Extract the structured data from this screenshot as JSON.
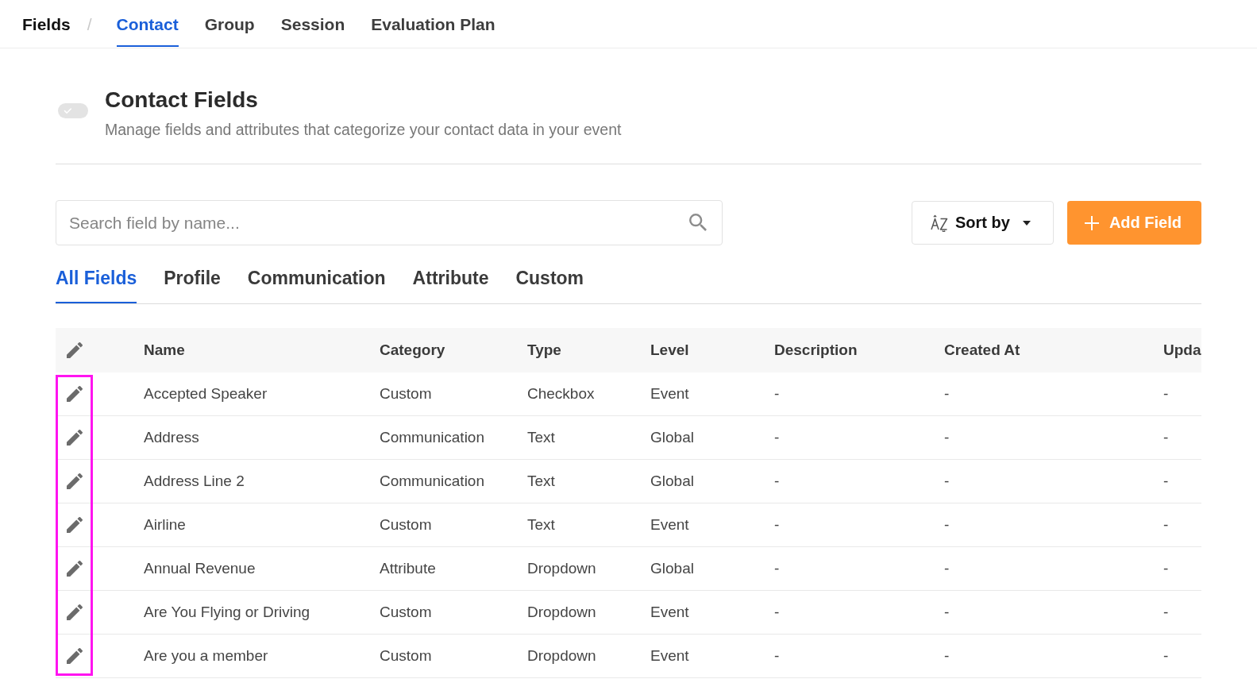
{
  "breadcrumb": {
    "root": "Fields",
    "separator": "/"
  },
  "nav_tabs": [
    {
      "label": "Contact",
      "selected": true
    },
    {
      "label": "Group",
      "selected": false
    },
    {
      "label": "Session",
      "selected": false
    },
    {
      "label": "Evaluation Plan",
      "selected": false
    }
  ],
  "header": {
    "toggle": {
      "on": true,
      "disabled": true
    },
    "title": "Contact Fields",
    "subtitle": "Manage fields and attributes that categorize your contact data in your event"
  },
  "toolbar": {
    "search": {
      "placeholder": "Search field by name..."
    },
    "sort_button": {
      "label": "Sort by"
    },
    "add_button": {
      "label": "Add Field"
    }
  },
  "category_tabs": [
    {
      "label": "All Fields",
      "selected": true
    },
    {
      "label": "Profile",
      "selected": false
    },
    {
      "label": "Communication",
      "selected": false
    },
    {
      "label": "Attribute",
      "selected": false
    },
    {
      "label": "Custom",
      "selected": false
    }
  ],
  "table": {
    "edit_column_highlighted": true,
    "columns": [
      "Name",
      "Category",
      "Type",
      "Level",
      "Description",
      "Created At",
      "Upda"
    ],
    "rows": [
      {
        "cells": [
          "Accepted Speaker",
          "Custom",
          "Checkbox",
          "Event",
          "-",
          "-",
          "-"
        ]
      },
      {
        "cells": [
          "Address",
          "Communication",
          "Text",
          "Global",
          "-",
          "-",
          "-"
        ]
      },
      {
        "cells": [
          "Address Line 2",
          "Communication",
          "Text",
          "Global",
          "-",
          "-",
          "-"
        ]
      },
      {
        "cells": [
          "Airline",
          "Custom",
          "Text",
          "Event",
          "-",
          "-",
          "-"
        ]
      },
      {
        "cells": [
          "Annual Revenue",
          "Attribute",
          "Dropdown",
          "Global",
          "-",
          "-",
          "-"
        ]
      },
      {
        "cells": [
          "Are You Flying or Driving",
          "Custom",
          "Dropdown",
          "Event",
          "-",
          "-",
          "-"
        ]
      },
      {
        "cells": [
          "Are you a member",
          "Custom",
          "Dropdown",
          "Event",
          "-",
          "-",
          "-"
        ]
      }
    ]
  }
}
